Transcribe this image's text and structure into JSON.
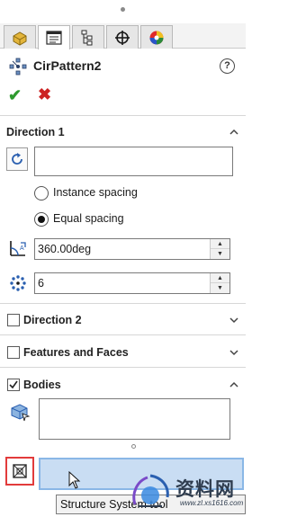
{
  "feature": {
    "title": "CirPattern2",
    "help": "?",
    "ok_symbol": "✔",
    "cancel_symbol": "✖"
  },
  "tabs": [
    {
      "name": "featuremanager",
      "icon": "featuremanager-tab-icon"
    },
    {
      "name": "propertymanager",
      "icon": "propertymanager-tab-icon",
      "active": true
    },
    {
      "name": "configurationmanager",
      "icon": "configurationmanager-tab-icon"
    },
    {
      "name": "dimxpertmanager",
      "icon": "dimxpertmanager-tab-icon"
    },
    {
      "name": "displaymanager",
      "icon": "displaymanager-tab-icon"
    }
  ],
  "direction1": {
    "label": "Direction 1",
    "axis_value": "",
    "radio_instance": "Instance spacing",
    "radio_equal": "Equal spacing",
    "selected_spacing": "Equal spacing",
    "angle": "360.00deg",
    "instances": "6"
  },
  "direction2": {
    "label": "Direction 2",
    "checked": false
  },
  "features_faces": {
    "label": "Features and Faces",
    "checked": false
  },
  "bodies": {
    "label": "Bodies",
    "checked": true,
    "list_value": ""
  },
  "tooltip": {
    "text": "Structure System tool"
  },
  "watermark": {
    "cn": "资料网",
    "url": "www.zl.xs1616.com"
  },
  "colors": {
    "ok": "#2e9a2e",
    "cancel": "#cc2222",
    "selection": "#c9ddf3",
    "highlight": "#e23b3b"
  }
}
